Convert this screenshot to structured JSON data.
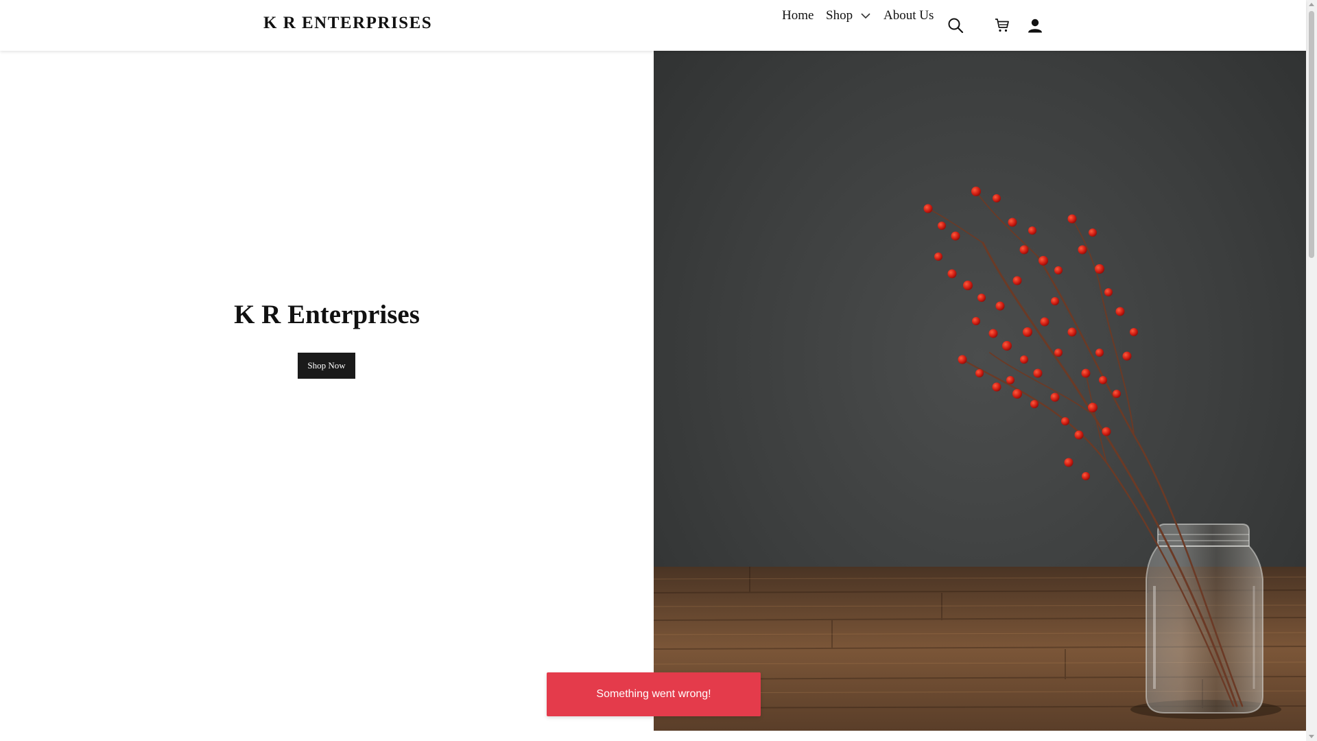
{
  "header": {
    "brand": "K R ENTERPRISES",
    "nav": {
      "home": "Home",
      "shop": "Shop",
      "about": "About Us"
    },
    "icons": {
      "search": "search-icon",
      "cart": "cart-icon",
      "account": "account-icon",
      "shop_dropdown": "chevron-down-icon"
    }
  },
  "hero": {
    "title": "K R Enterprises",
    "cta_label": "Shop Now",
    "image": "red berry branches in glass jar on wooden table"
  },
  "toast": {
    "message": "Something went wrong!",
    "color": "#e43b4b"
  },
  "colors": {
    "button_bg": "#1a1a1a",
    "text": "#111111"
  }
}
